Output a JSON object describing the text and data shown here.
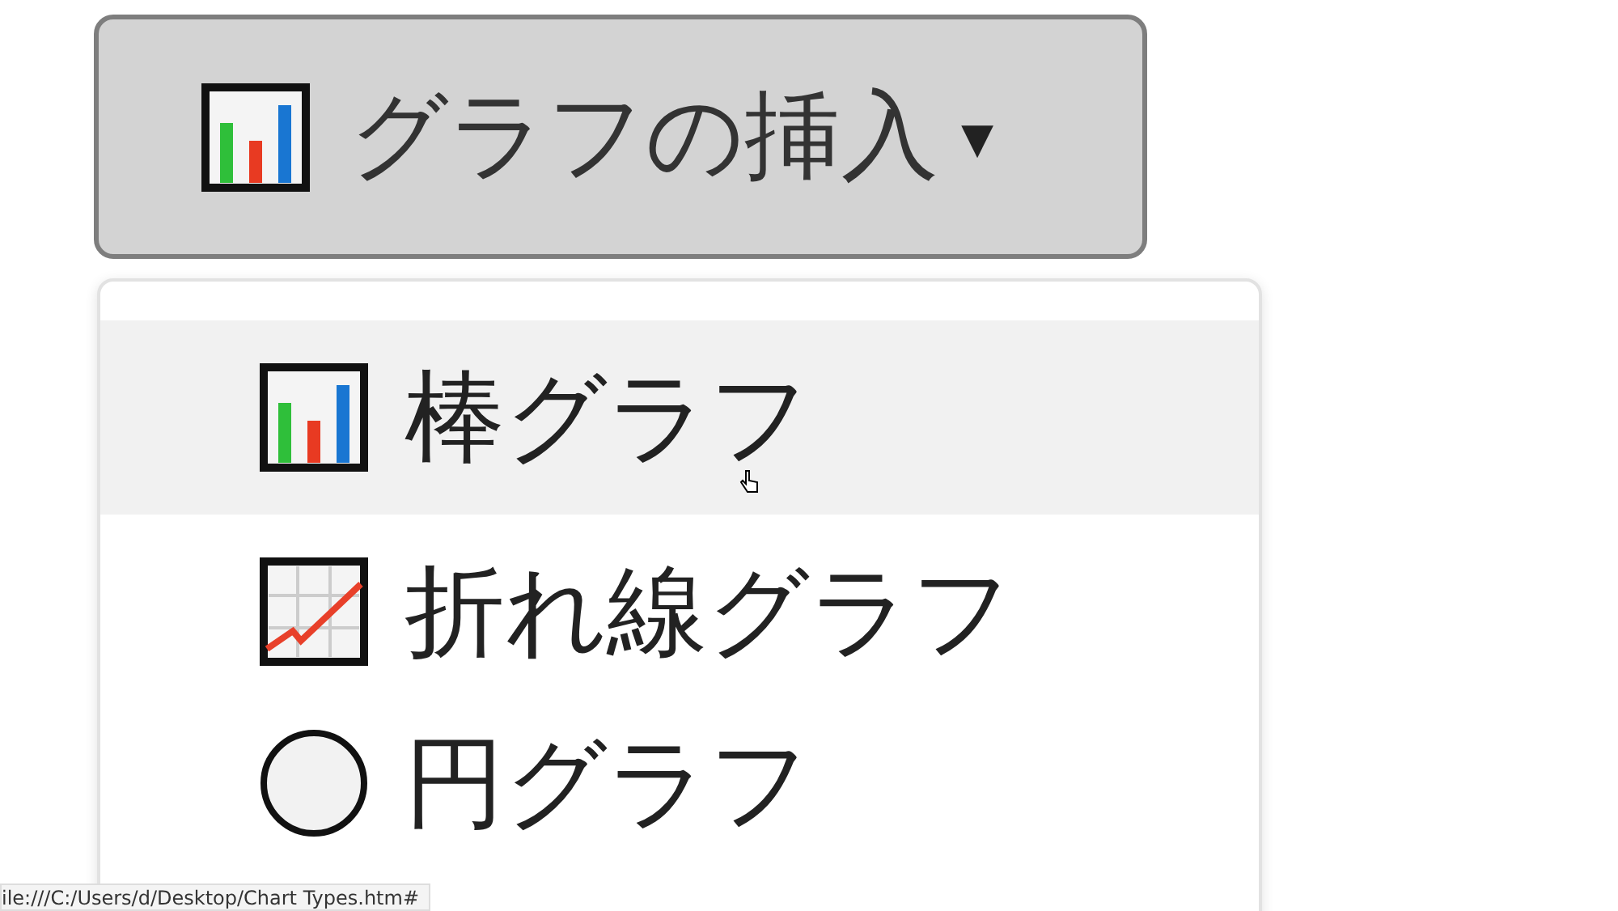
{
  "button": {
    "label": "グラフの挿入",
    "caret": "▾"
  },
  "menu": {
    "items": [
      {
        "label": "棒グラフ",
        "kind": "bar",
        "selected": true
      },
      {
        "label": "折れ線グラフ",
        "kind": "line",
        "selected": false
      },
      {
        "label": "円グラフ",
        "kind": "pie",
        "selected": false
      }
    ]
  },
  "status_bar": {
    "url": "ile:///C:/Users/d/Desktop/Chart Types.htm#"
  }
}
